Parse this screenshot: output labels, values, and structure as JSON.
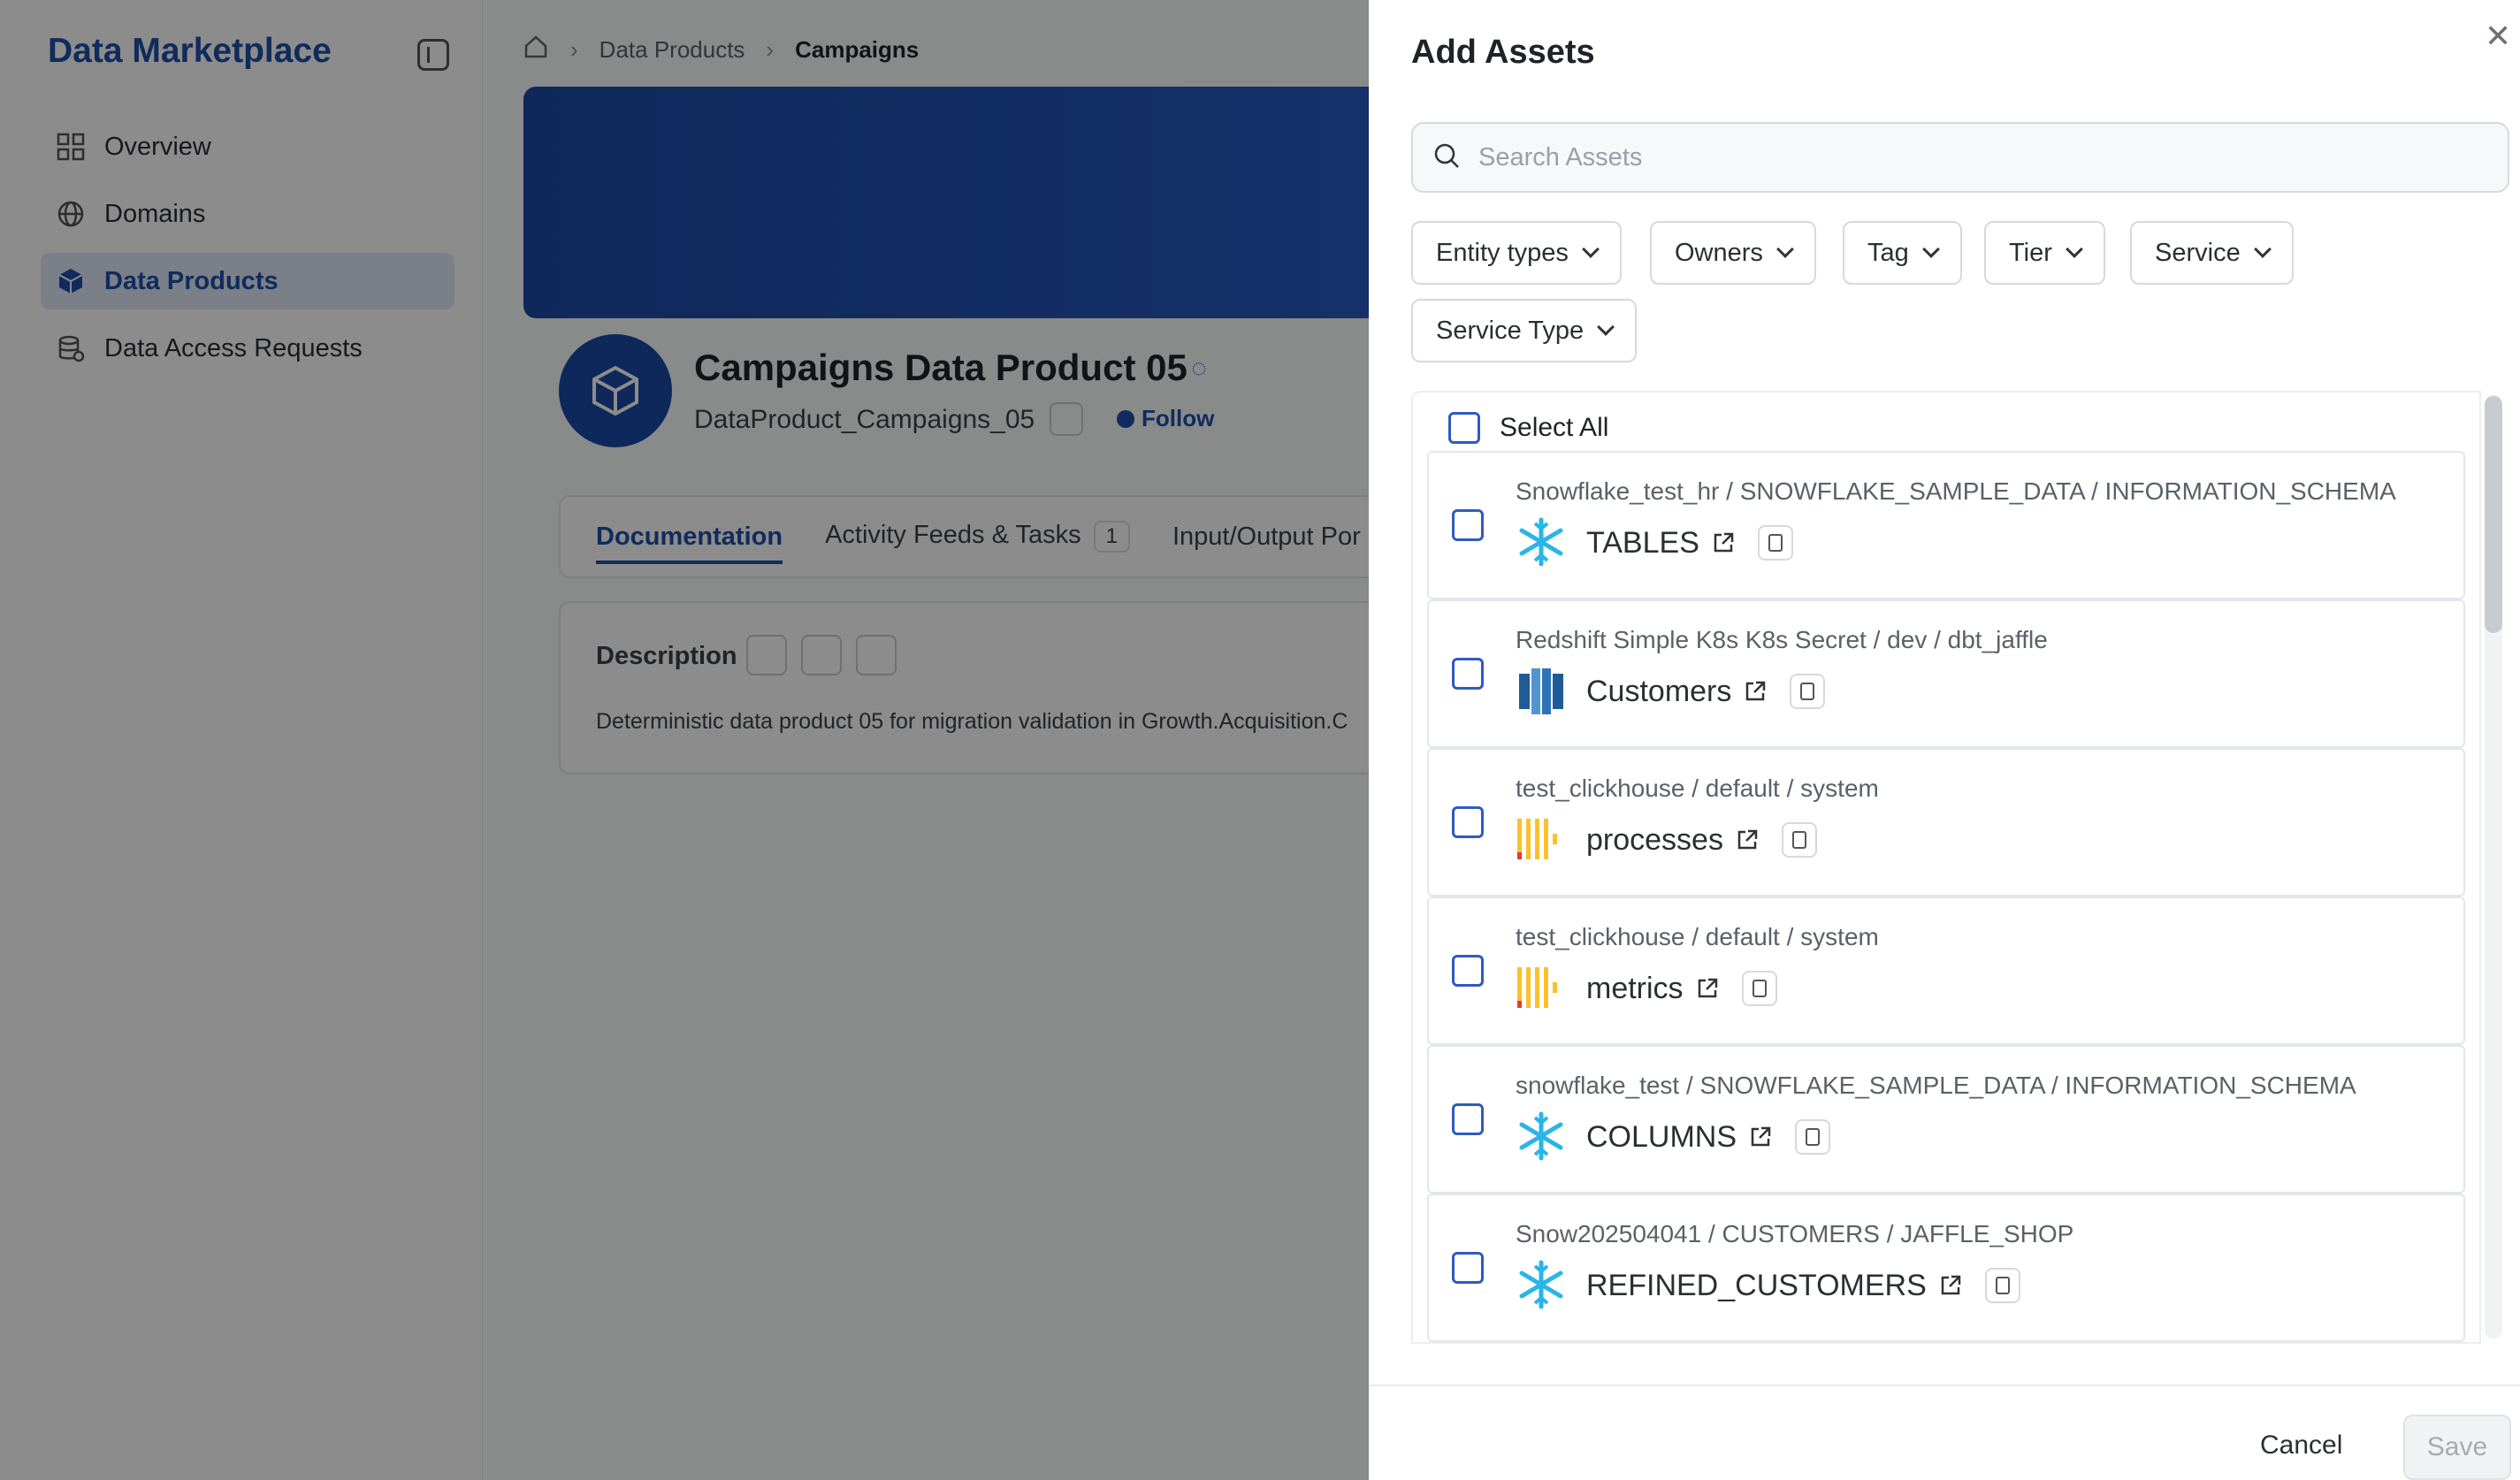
{
  "sidebar": {
    "title": "Data Marketplace",
    "items": [
      {
        "label": "Overview",
        "icon": "grid-icon"
      },
      {
        "label": "Domains",
        "icon": "globe-icon"
      },
      {
        "label": "Data Products",
        "icon": "cube-icon",
        "active": true
      },
      {
        "label": "Data Access Requests",
        "icon": "database-icon"
      }
    ]
  },
  "breadcrumb": {
    "home_icon": "home-icon",
    "items": [
      "Data Products",
      "Campaigns"
    ]
  },
  "product": {
    "title": "Campaigns Data Product 05",
    "fqn": "DataProduct_Campaigns_05",
    "follow_label": "Follow"
  },
  "tabs": [
    {
      "label": "Documentation",
      "active": true
    },
    {
      "label": "Activity Feeds & Tasks",
      "count": "1"
    },
    {
      "label": "Input/Output Por"
    }
  ],
  "description": {
    "label": "Description",
    "text": "Deterministic data product 05 for migration validation in Growth.Acquisition.C"
  },
  "drawer": {
    "title": "Add Assets",
    "search_placeholder": "Search Assets",
    "filters": [
      "Entity types",
      "Owners",
      "Tag",
      "Tier",
      "Service",
      "Service Type"
    ],
    "select_all_label": "Select All",
    "assets": [
      {
        "path": "Snowflake_test_hr  /  SNOWFLAKE_SAMPLE_DATA  /  INFORMATION_SCHEMA",
        "name": "TABLES",
        "icon": "snowflake-icon"
      },
      {
        "path": "Redshift Simple K8s K8s Secret  /  dev  /  dbt_jaffle",
        "name": "Customers",
        "icon": "redshift-icon"
      },
      {
        "path": "test_clickhouse  /  default  /  system",
        "name": "processes",
        "icon": "clickhouse-icon"
      },
      {
        "path": "test_clickhouse  /  default  /  system",
        "name": "metrics",
        "icon": "clickhouse-icon"
      },
      {
        "path": "snowflake_test  /  SNOWFLAKE_SAMPLE_DATA  /  INFORMATION_SCHEMA",
        "name": "COLUMNS",
        "icon": "snowflake-icon"
      },
      {
        "path": "Snow202504041  /  CUSTOMERS  /  JAFFLE_SHOP",
        "name": "REFINED_CUSTOMERS",
        "icon": "snowflake-icon"
      }
    ],
    "cancel_label": "Cancel",
    "save_label": "Save"
  },
  "colors": {
    "accent": "#1f4fa8",
    "banner": "#1b4aa6",
    "checkbox": "#2f5bc0"
  }
}
